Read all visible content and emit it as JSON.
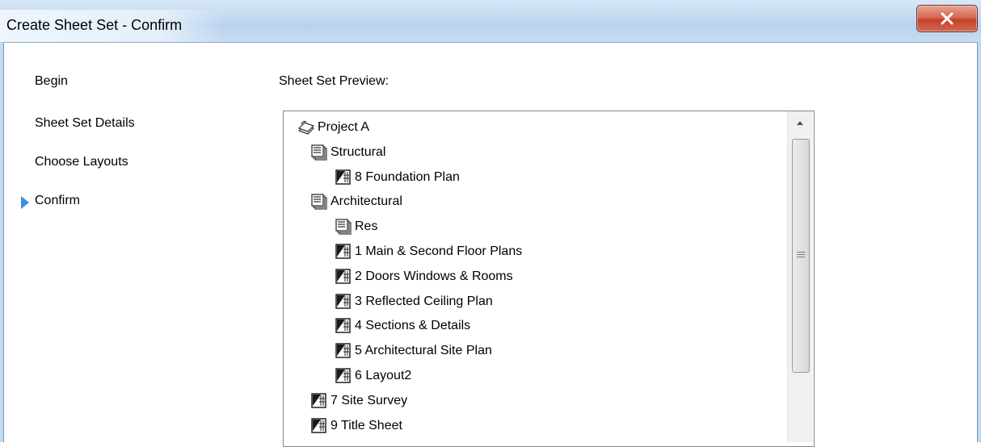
{
  "window": {
    "title": "Create Sheet Set - Confirm",
    "close_glyph": "x"
  },
  "nav": {
    "items": [
      {
        "label": "Begin"
      },
      {
        "label": "Sheet Set Details"
      },
      {
        "label": "Choose Layouts"
      },
      {
        "label": "Confirm",
        "current": true
      }
    ]
  },
  "preview": {
    "label": "Sheet Set Preview:",
    "tree": [
      {
        "label": "Project A",
        "icon": "sheet-set-icon",
        "depth": 0
      },
      {
        "label": "Structural",
        "icon": "subset-icon",
        "depth": 1
      },
      {
        "label": "8 Foundation Plan",
        "icon": "sheet-icon",
        "depth": 2
      },
      {
        "label": "Architectural",
        "icon": "subset-icon",
        "depth": 1
      },
      {
        "label": "Res",
        "icon": "subset-icon",
        "depth": 2
      },
      {
        "label": "1 Main & Second Floor Plans",
        "icon": "sheet-icon",
        "depth": 2
      },
      {
        "label": "2 Doors Windows & Rooms",
        "icon": "sheet-icon",
        "depth": 2
      },
      {
        "label": "3 Reflected Ceiling Plan",
        "icon": "sheet-icon",
        "depth": 2
      },
      {
        "label": "4 Sections & Details",
        "icon": "sheet-icon",
        "depth": 2
      },
      {
        "label": "5 Architectural Site Plan",
        "icon": "sheet-icon",
        "depth": 2
      },
      {
        "label": "6 Layout2",
        "icon": "sheet-icon",
        "depth": 2
      },
      {
        "label": "7 Site Survey",
        "icon": "sheet-icon",
        "depth": 1
      },
      {
        "label": "9 Title Sheet",
        "icon": "sheet-icon",
        "depth": 1
      }
    ]
  },
  "colors": {
    "accent_arrow": "#3d8fe0",
    "close_button": "#c5412a"
  }
}
